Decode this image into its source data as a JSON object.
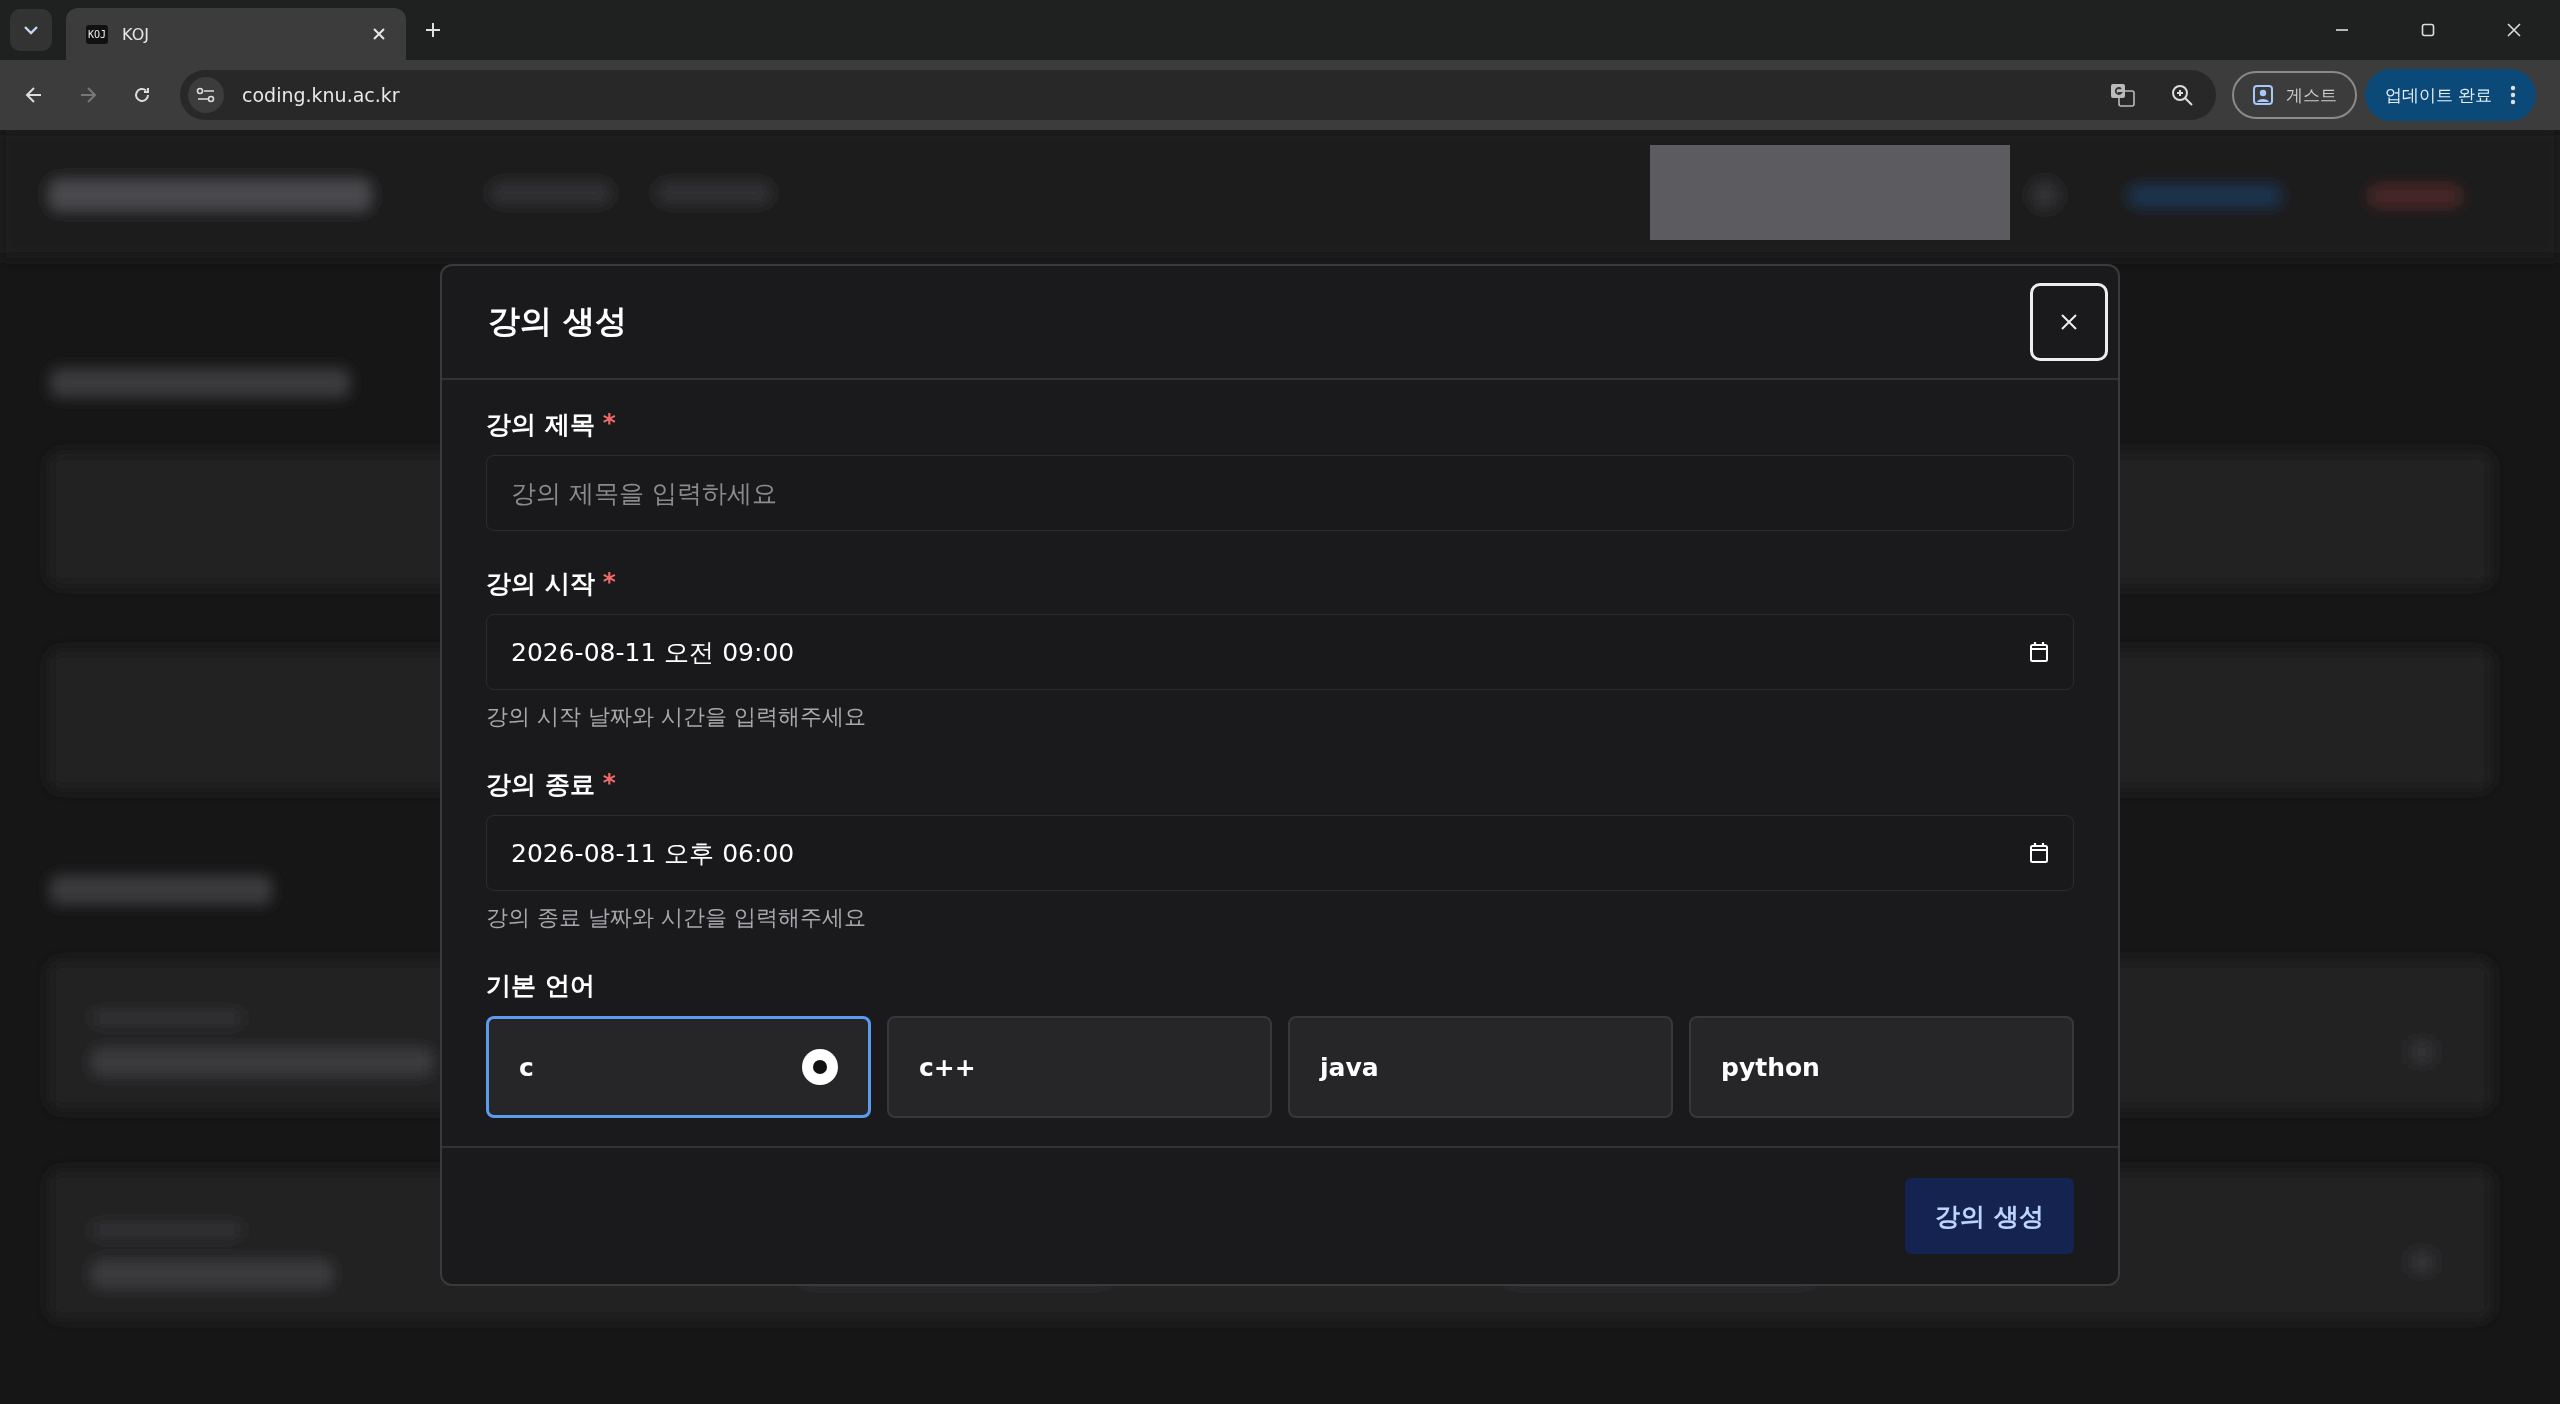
{
  "browser": {
    "tab": {
      "favicon": "KOJ",
      "title": "KOJ"
    },
    "url": "coding.knu.ac.kr",
    "profile": "게스트",
    "update_button": "업데이트 완료"
  },
  "dialog": {
    "title": "강의 생성",
    "fields": [
      {
        "kind": "text",
        "label": "강의 제목",
        "required_mark": "*",
        "placeholder": "강의 제목을 입력하세요"
      },
      {
        "kind": "datetime",
        "label": "강의 시작",
        "required_mark": "*",
        "value": "2026-08-11 오전 09:00",
        "help": "강의 시작 날짜와 시간을 입력해주세요"
      },
      {
        "kind": "datetime",
        "label": "강의 종료",
        "required_mark": "*",
        "value": "2026-08-11 오후 06:00",
        "help": "강의 종료 날짜와 시간을 입력해주세요"
      }
    ],
    "language": {
      "label": "기본 언어",
      "options": [
        {
          "label": "c",
          "selected": true
        },
        {
          "label": "c++",
          "selected": false
        },
        {
          "label": "java",
          "selected": false
        },
        {
          "label": "python",
          "selected": false
        }
      ]
    },
    "submit": "강의 생성"
  }
}
